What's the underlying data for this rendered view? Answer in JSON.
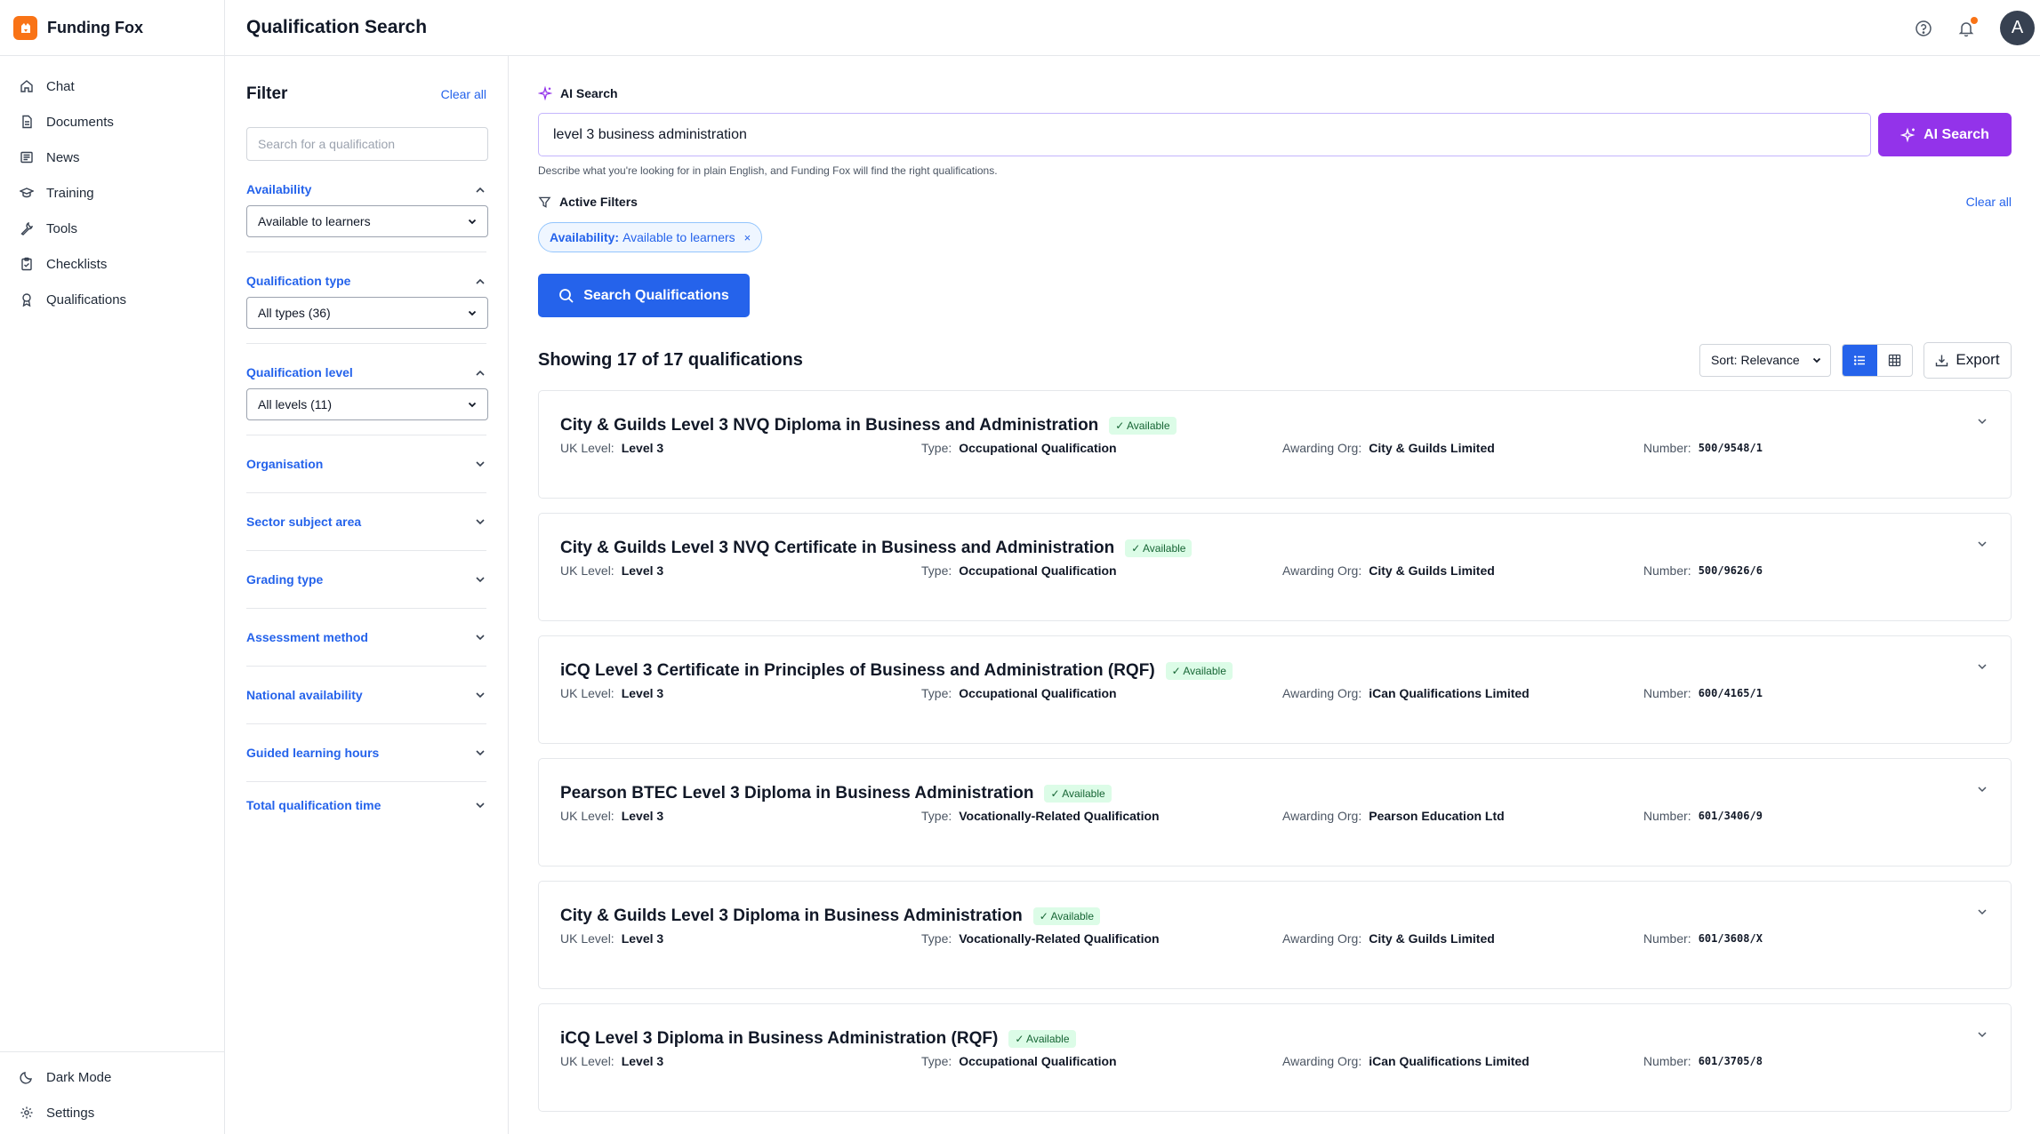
{
  "app": {
    "name": "Funding Fox",
    "page_title": "Qualification Search"
  },
  "nav": {
    "items": [
      {
        "label": "Chat",
        "icon": "home-icon"
      },
      {
        "label": "Documents",
        "icon": "document-icon"
      },
      {
        "label": "News",
        "icon": "newspaper-icon"
      },
      {
        "label": "Training",
        "icon": "graduation-cap-icon"
      },
      {
        "label": "Tools",
        "icon": "wrench-icon"
      },
      {
        "label": "Checklists",
        "icon": "clipboard-icon"
      },
      {
        "label": "Qualifications",
        "icon": "award-icon"
      }
    ],
    "bottom": [
      {
        "label": "Dark Mode",
        "icon": "moon-icon"
      },
      {
        "label": "Settings",
        "icon": "gear-icon"
      }
    ]
  },
  "header": {
    "avatar_initial": "A"
  },
  "filter": {
    "title": "Filter",
    "clear_all": "Clear all",
    "search_placeholder": "Search for a qualification",
    "open_sections": [
      {
        "label": "Availability",
        "value": "Available to learners"
      },
      {
        "label": "Qualification type",
        "value": "All types (36)"
      },
      {
        "label": "Qualification level",
        "value": "All levels (11)"
      }
    ],
    "collapsed_sections": [
      "Organisation",
      "Sector subject area",
      "Grading type",
      "Assessment method",
      "National availability",
      "Guided learning hours",
      "Total qualification time"
    ]
  },
  "ai_search": {
    "label": "AI Search",
    "query": "level 3 business administration",
    "button": "AI Search",
    "help": "Describe what you're looking for in plain English, and Funding Fox will find the right qualifications."
  },
  "active_filters": {
    "title": "Active Filters",
    "clear_all": "Clear all",
    "chip_key": "Availability:",
    "chip_value": "Available to learners",
    "chip_remove": "×"
  },
  "search_button": "Search Qualifications",
  "results": {
    "count_text": "Showing 17 of 17 qualifications",
    "sort_label": "Sort: Relevance",
    "export_label": "Export",
    "labels": {
      "level": "UK Level:",
      "type": "Type:",
      "org": "Awarding Org:",
      "number": "Number:"
    },
    "items": [
      {
        "title": "City & Guilds Level 3 NVQ Diploma in Business and Administration",
        "badge": "✓ Available",
        "level": "Level 3",
        "type": "Occupational Qualification",
        "org": "City & Guilds Limited",
        "number": "500/9548/1"
      },
      {
        "title": "City & Guilds Level 3 NVQ Certificate in Business and Administration",
        "badge": "✓ Available",
        "level": "Level 3",
        "type": "Occupational Qualification",
        "org": "City & Guilds Limited",
        "number": "500/9626/6"
      },
      {
        "title": "iCQ Level 3 Certificate in Principles of Business and Administration (RQF)",
        "badge": "✓ Available",
        "level": "Level 3",
        "type": "Occupational Qualification",
        "org": "iCan Qualifications Limited",
        "number": "600/4165/1"
      },
      {
        "title": "Pearson BTEC Level 3 Diploma in Business Administration",
        "badge": "✓ Available",
        "level": "Level 3",
        "type": "Vocationally-Related Qualification",
        "org": "Pearson Education Ltd",
        "number": "601/3406/9"
      },
      {
        "title": "City & Guilds Level 3 Diploma in Business Administration",
        "badge": "✓ Available",
        "level": "Level 3",
        "type": "Vocationally-Related Qualification",
        "org": "City & Guilds Limited",
        "number": "601/3608/X"
      },
      {
        "title": "iCQ Level 3 Diploma in Business Administration (RQF)",
        "badge": "✓ Available",
        "level": "Level 3",
        "type": "Occupational Qualification",
        "org": "iCan Qualifications Limited",
        "number": "601/3705/8"
      }
    ]
  },
  "colors": {
    "brand": "#f97316",
    "primary": "#2563eb",
    "ai": "#9333ea",
    "success_bg": "#dcfce7",
    "success_text": "#166534"
  }
}
